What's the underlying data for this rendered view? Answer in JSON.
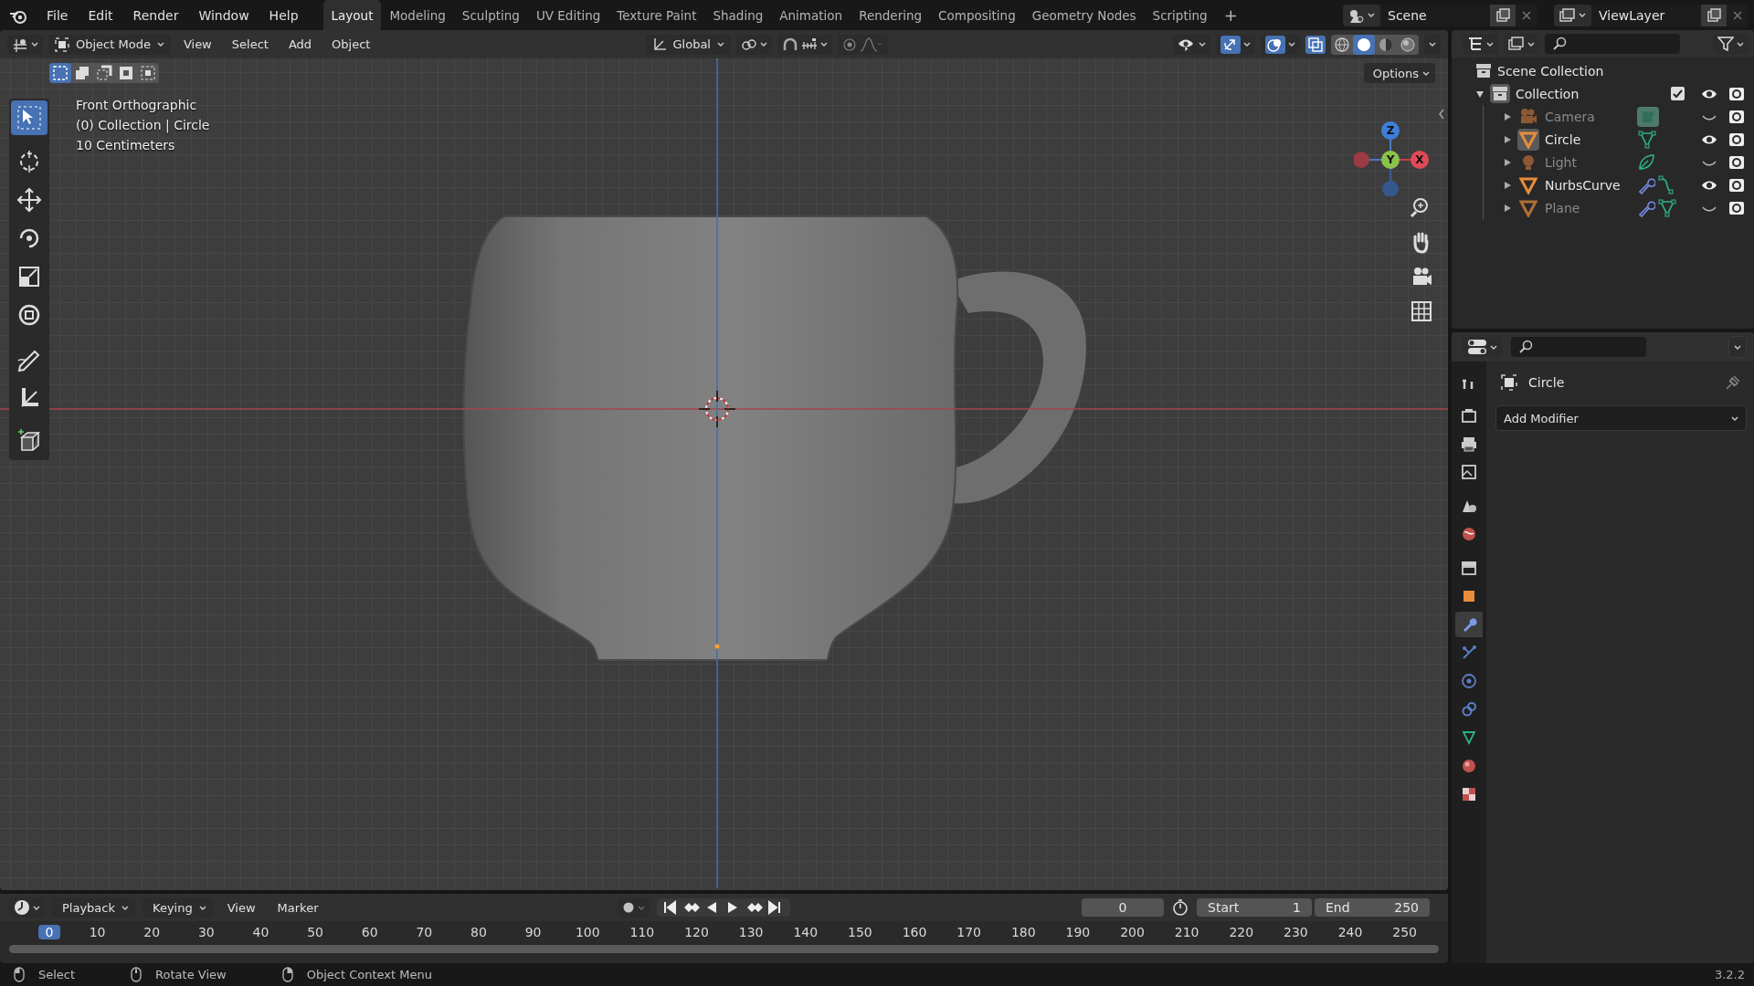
{
  "menu": [
    "File",
    "Edit",
    "Render",
    "Window",
    "Help"
  ],
  "workspaces": [
    {
      "label": "Layout",
      "selected": true
    },
    {
      "label": "Modeling",
      "selected": false
    },
    {
      "label": "Sculpting",
      "selected": false
    },
    {
      "label": "UV Editing",
      "selected": false
    },
    {
      "label": "Texture Paint",
      "selected": false
    },
    {
      "label": "Shading",
      "selected": false
    },
    {
      "label": "Animation",
      "selected": false
    },
    {
      "label": "Rendering",
      "selected": false
    },
    {
      "label": "Compositing",
      "selected": false
    },
    {
      "label": "Geometry Nodes",
      "selected": false
    },
    {
      "label": "Scripting",
      "selected": false
    }
  ],
  "add_workspace": "+",
  "scene": "Scene",
  "view_layer": "ViewLayer",
  "viewport": {
    "mode": "Object Mode",
    "menus": [
      "View",
      "Select",
      "Add",
      "Object"
    ],
    "orientation": "Global",
    "options": "Options",
    "select_modes": [
      {
        "selected": true
      },
      {
        "selected": false
      },
      {
        "selected": false
      },
      {
        "selected": false
      },
      {
        "selected": false
      }
    ],
    "shading": [
      {
        "selected": false
      },
      {
        "selected": true
      },
      {
        "selected": false
      },
      {
        "selected": false
      }
    ],
    "info": [
      "Front Orthographic",
      "(0) Collection | Circle",
      "10 Centimeters"
    ],
    "gizmo": {
      "z": "Z",
      "y": "Y",
      "x": "X"
    },
    "tools": [
      {
        "selected": true
      },
      {
        "selected": false
      },
      {
        "selected": false
      },
      {
        "selected": false
      },
      {
        "selected": false
      },
      {
        "selected": false
      },
      {
        "selected": false
      },
      {
        "selected": false
      },
      {
        "selected": false
      }
    ]
  },
  "outliner": {
    "root": "Scene Collection",
    "collection": {
      "label": "Collection",
      "expanded": true,
      "checked": true,
      "visible": true,
      "children": [
        {
          "label": "Camera",
          "kind": "camera",
          "visible": false,
          "active": false,
          "modifier": false
        },
        {
          "label": "Circle",
          "kind": "mesh",
          "visible": true,
          "active": true,
          "modifier": false
        },
        {
          "label": "Light",
          "kind": "light",
          "visible": false,
          "active": false,
          "modifier": false
        },
        {
          "label": "NurbsCurve",
          "kind": "curve",
          "visible": true,
          "active": false,
          "modifier": true
        },
        {
          "label": "Plane",
          "kind": "mesh",
          "visible": false,
          "active": false,
          "modifier": true
        }
      ]
    }
  },
  "properties": {
    "object": "Circle",
    "add_modifier": "Add Modifier",
    "tabs": [
      {
        "selected": false
      },
      {
        "selected": false
      },
      {
        "selected": false
      },
      {
        "selected": false
      },
      {
        "selected": false
      },
      {
        "selected": false
      },
      {
        "selected": false
      },
      {
        "selected": false
      },
      {
        "selected": true
      },
      {
        "selected": false
      },
      {
        "selected": false
      },
      {
        "selected": false
      },
      {
        "selected": false
      },
      {
        "selected": false
      },
      {
        "selected": false
      }
    ]
  },
  "timeline": {
    "menus": [
      "Playback",
      "Keying",
      "View",
      "Marker"
    ],
    "current_frame": "0",
    "start_label": "Start",
    "start": "1",
    "end_label": "End",
    "end": "250",
    "ruler": [
      {
        "label": "0",
        "current": true
      },
      {
        "label": "10",
        "current": false
      },
      {
        "label": "20",
        "current": false
      },
      {
        "label": "30",
        "current": false
      },
      {
        "label": "40",
        "current": false
      },
      {
        "label": "50",
        "current": false
      },
      {
        "label": "60",
        "current": false
      },
      {
        "label": "70",
        "current": false
      },
      {
        "label": "80",
        "current": false
      },
      {
        "label": "90",
        "current": false
      },
      {
        "label": "100",
        "current": false
      },
      {
        "label": "110",
        "current": false
      },
      {
        "label": "120",
        "current": false
      },
      {
        "label": "130",
        "current": false
      },
      {
        "label": "140",
        "current": false
      },
      {
        "label": "150",
        "current": false
      },
      {
        "label": "160",
        "current": false
      },
      {
        "label": "170",
        "current": false
      },
      {
        "label": "180",
        "current": false
      },
      {
        "label": "190",
        "current": false
      },
      {
        "label": "200",
        "current": false
      },
      {
        "label": "210",
        "current": false
      },
      {
        "label": "220",
        "current": false
      },
      {
        "label": "230",
        "current": false
      },
      {
        "label": "240",
        "current": false
      },
      {
        "label": "250",
        "current": false
      }
    ]
  },
  "status_bar": {
    "hints": [
      "Select",
      "Rotate View",
      "Object Context Menu"
    ],
    "version": "3.2.2"
  }
}
